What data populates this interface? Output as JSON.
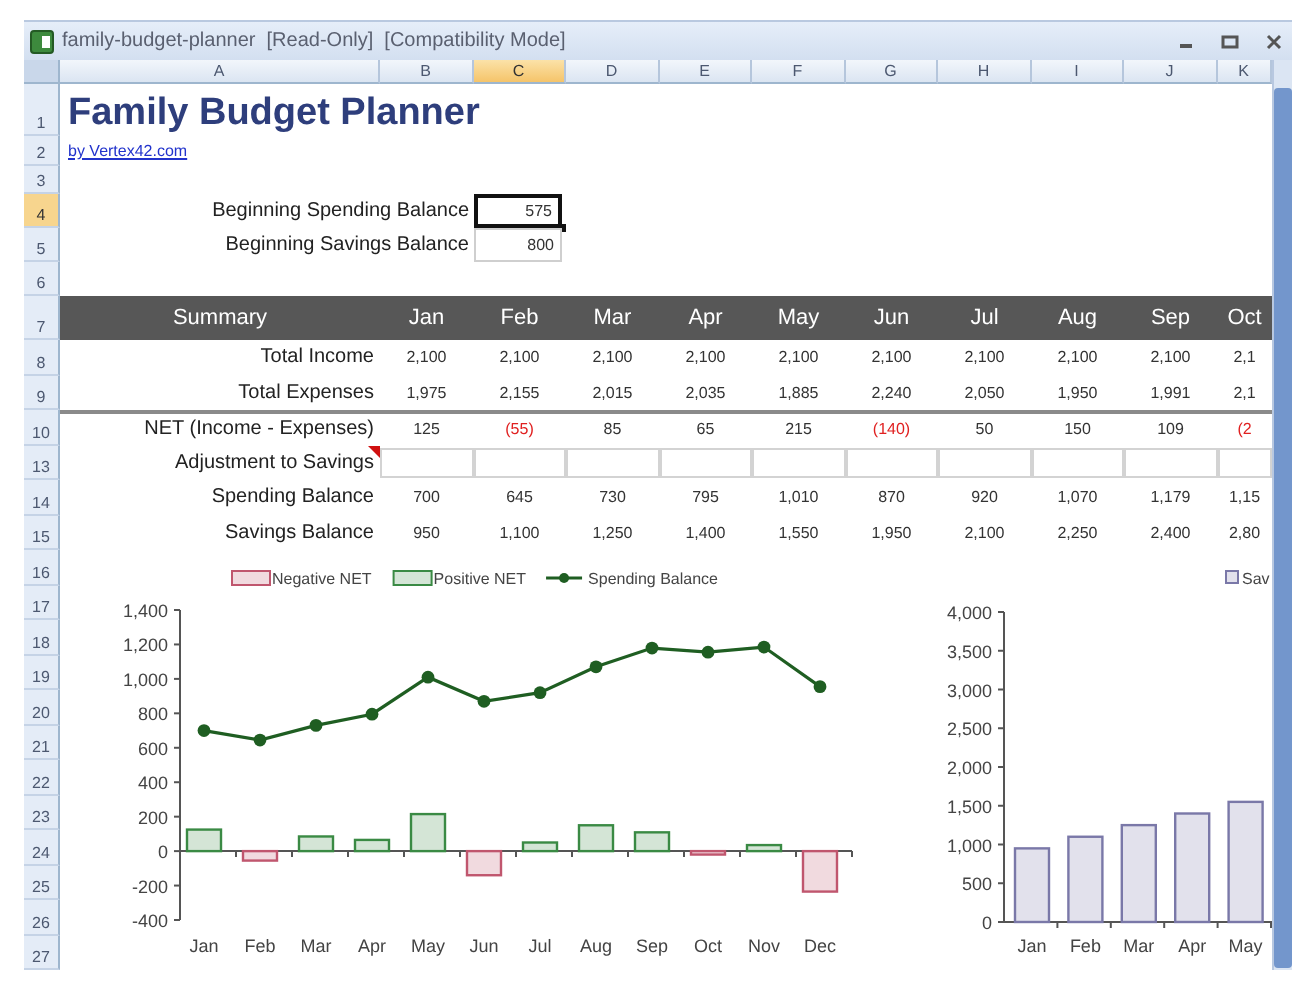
{
  "window": {
    "title": "family-budget-planner  [Read-Only]  [Compatibility Mode]"
  },
  "column_headers": [
    {
      "label": "A",
      "selected": false
    },
    {
      "label": "B",
      "selected": false
    },
    {
      "label": "C",
      "selected": true
    },
    {
      "label": "D",
      "selected": false
    },
    {
      "label": "E",
      "selected": false
    },
    {
      "label": "F",
      "selected": false
    },
    {
      "label": "G",
      "selected": false
    },
    {
      "label": "H",
      "selected": false
    },
    {
      "label": "I",
      "selected": false
    },
    {
      "label": "J",
      "selected": false
    },
    {
      "label": "K",
      "selected": false
    }
  ],
  "row_numbers": [
    {
      "label": "1",
      "selected": false
    },
    {
      "label": "2",
      "selected": false
    },
    {
      "label": "3",
      "selected": false
    },
    {
      "label": "4",
      "selected": true
    },
    {
      "label": "5",
      "selected": false
    },
    {
      "label": "6",
      "selected": false
    },
    {
      "label": "7",
      "selected": false
    },
    {
      "label": "8",
      "selected": false
    },
    {
      "label": "9",
      "selected": false
    },
    {
      "label": "10",
      "selected": false
    },
    {
      "label": "13",
      "selected": false
    },
    {
      "label": "14",
      "selected": false
    },
    {
      "label": "15",
      "selected": false
    },
    {
      "label": "16",
      "selected": false
    },
    {
      "label": "17",
      "selected": false
    },
    {
      "label": "18",
      "selected": false
    },
    {
      "label": "19",
      "selected": false
    },
    {
      "label": "20",
      "selected": false
    },
    {
      "label": "21",
      "selected": false
    },
    {
      "label": "22",
      "selected": false
    },
    {
      "label": "23",
      "selected": false
    },
    {
      "label": "24",
      "selected": false
    },
    {
      "label": "25",
      "selected": false
    },
    {
      "label": "26",
      "selected": false
    },
    {
      "label": "27",
      "selected": false
    }
  ],
  "title": "Family Budget Planner",
  "link": "by Vertex42.com",
  "balances": [
    {
      "label": "Beginning Spending Balance",
      "value": "575",
      "selected": true
    },
    {
      "label": "Beginning Savings Balance",
      "value": "800",
      "selected": false
    }
  ],
  "summary": {
    "columns": [
      "Summary",
      "Jan",
      "Feb",
      "Mar",
      "Apr",
      "May",
      "Jun",
      "Jul",
      "Aug",
      "Sep",
      "Oct"
    ],
    "rows": [
      {
        "label": "Total Income",
        "kind": "values",
        "cells": [
          "2,100",
          "2,100",
          "2,100",
          "2,100",
          "2,100",
          "2,100",
          "2,100",
          "2,100",
          "2,100",
          "2,1"
        ]
      },
      {
        "label": "Total Expenses",
        "kind": "values",
        "cells": [
          "1,975",
          "2,155",
          "2,015",
          "2,035",
          "1,885",
          "2,240",
          "2,050",
          "1,950",
          "1,991",
          "2,1"
        ]
      },
      {
        "label": "NET (Income - Expenses)",
        "kind": "signed",
        "cells": [
          {
            "text": "125",
            "negative": false
          },
          {
            "text": "(55)",
            "negative": true
          },
          {
            "text": "85",
            "negative": false
          },
          {
            "text": "65",
            "negative": false
          },
          {
            "text": "215",
            "negative": false
          },
          {
            "text": "(140)",
            "negative": true
          },
          {
            "text": "50",
            "negative": false
          },
          {
            "text": "150",
            "negative": false
          },
          {
            "text": "109",
            "negative": false
          },
          {
            "text": "(2",
            "negative": true
          }
        ]
      },
      {
        "label": "Adjustment to Savings",
        "kind": "input",
        "comment": true
      },
      {
        "label": "Spending Balance",
        "kind": "values",
        "cells": [
          "700",
          "645",
          "730",
          "795",
          "1,010",
          "870",
          "920",
          "1,070",
          "1,179",
          "1,15"
        ]
      },
      {
        "label": "Savings Balance",
        "kind": "values",
        "cells": [
          "950",
          "1,100",
          "1,250",
          "1,400",
          "1,550",
          "1,950",
          "2,100",
          "2,250",
          "2,400",
          "2,80"
        ]
      }
    ]
  },
  "charts": [
    {
      "chart_data": {
        "type": "bar",
        "categories": [
          "Jan",
          "Feb",
          "Mar",
          "Apr",
          "May",
          "Jun",
          "Jul",
          "Aug",
          "Sep",
          "Oct",
          "Nov",
          "Dec"
        ],
        "series": [
          {
            "name": "Negative NET",
            "color": "#c0566e",
            "values": [
              null,
              -55,
              null,
              null,
              null,
              -140,
              null,
              null,
              null,
              -20,
              null,
              -235
            ]
          },
          {
            "name": "Positive NET",
            "color": "#3a8a44",
            "values": [
              125,
              null,
              85,
              65,
              215,
              null,
              50,
              150,
              109,
              null,
              35,
              null
            ]
          },
          {
            "name": "Spending Balance",
            "type": "line",
            "marker": "circle",
            "color": "#1f5e22",
            "values": [
              700,
              645,
              730,
              795,
              1010,
              870,
              920,
              1070,
              1179,
              1155,
              1185,
              955
            ]
          }
        ],
        "legend": true,
        "ylim": [
          -400,
          1400
        ],
        "yticks": [
          {
            "value": -400,
            "label": "-400"
          },
          {
            "value": -200,
            "label": "-200"
          },
          0,
          200,
          400,
          600,
          {
            "value": 800,
            "label": "800"
          },
          {
            "value": 1000,
            "label": "1,000"
          },
          {
            "value": 1200,
            "label": "1,200"
          },
          {
            "value": 1400,
            "label": "1,400"
          }
        ]
      }
    },
    {
      "chart_data": {
        "type": "bar",
        "categories": [
          "Jan",
          "Feb",
          "Mar",
          "Apr",
          "May"
        ],
        "series": [
          {
            "name": "Sav",
            "color": "#7a78a8",
            "values": [
              950,
              1100,
              1250,
              1400,
              1550
            ]
          }
        ],
        "legend": true,
        "ylim": [
          0,
          4000
        ],
        "yticks": [
          0,
          500,
          {
            "value": 1000,
            "label": "1,000"
          },
          {
            "value": 1500,
            "label": "1,500"
          },
          {
            "value": 2000,
            "label": "2,000"
          },
          {
            "value": 2500,
            "label": "2,500"
          },
          {
            "value": 3000,
            "label": "3,000"
          },
          {
            "value": 3500,
            "label": "3,500"
          },
          {
            "value": 4000,
            "label": "4,000"
          }
        ]
      }
    }
  ]
}
